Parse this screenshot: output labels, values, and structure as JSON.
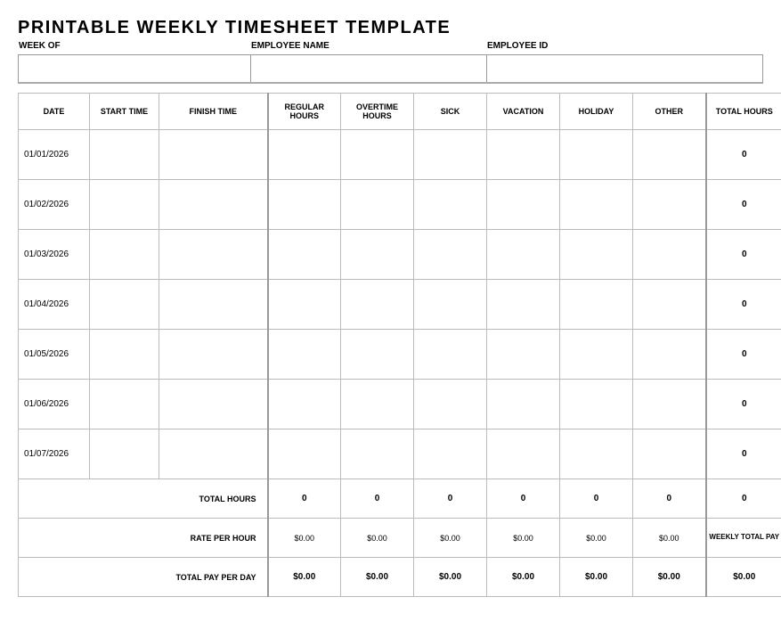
{
  "title": "PRINTABLE WEEKLY TIMESHEET TEMPLATE",
  "header": {
    "weekOfLabel": "WEEK OF",
    "weekOf": "",
    "employeeNameLabel": "EMPLOYEE NAME",
    "employeeName": "",
    "employeeIdLabel": "EMPLOYEE ID",
    "employeeId": ""
  },
  "columns": {
    "date": "DATE",
    "startTime": "START TIME",
    "finishTime": "FINISH TIME",
    "regular": "REGULAR HOURS",
    "overtime": "OVERTIME HOURS",
    "sick": "SICK",
    "vacation": "VACATION",
    "holiday": "HOLIDAY",
    "other": "OTHER",
    "total": "TOTAL HOURS"
  },
  "rows": [
    {
      "date": "01/01/2026",
      "start": "",
      "finish": "",
      "reg": "",
      "ot": "",
      "sick": "",
      "vac": "",
      "hol": "",
      "other": "",
      "total": "0"
    },
    {
      "date": "01/02/2026",
      "start": "",
      "finish": "",
      "reg": "",
      "ot": "",
      "sick": "",
      "vac": "",
      "hol": "",
      "other": "",
      "total": "0"
    },
    {
      "date": "01/03/2026",
      "start": "",
      "finish": "",
      "reg": "",
      "ot": "",
      "sick": "",
      "vac": "",
      "hol": "",
      "other": "",
      "total": "0"
    },
    {
      "date": "01/04/2026",
      "start": "",
      "finish": "",
      "reg": "",
      "ot": "",
      "sick": "",
      "vac": "",
      "hol": "",
      "other": "",
      "total": "0"
    },
    {
      "date": "01/05/2026",
      "start": "",
      "finish": "",
      "reg": "",
      "ot": "",
      "sick": "",
      "vac": "",
      "hol": "",
      "other": "",
      "total": "0"
    },
    {
      "date": "01/06/2026",
      "start": "",
      "finish": "",
      "reg": "",
      "ot": "",
      "sick": "",
      "vac": "",
      "hol": "",
      "other": "",
      "total": "0"
    },
    {
      "date": "01/07/2026",
      "start": "",
      "finish": "",
      "reg": "",
      "ot": "",
      "sick": "",
      "vac": "",
      "hol": "",
      "other": "",
      "total": "0"
    }
  ],
  "footer": {
    "totalHoursLabel": "TOTAL HOURS",
    "totals": {
      "reg": "0",
      "ot": "0",
      "sick": "0",
      "vac": "0",
      "hol": "0",
      "other": "0",
      "grand": "0"
    },
    "rateLabel": "RATE PER HOUR",
    "rates": {
      "reg": "$0.00",
      "ot": "$0.00",
      "sick": "$0.00",
      "vac": "$0.00",
      "hol": "$0.00",
      "other": "$0.00"
    },
    "weeklyTotalPayLabel": "WEEKLY TOTAL PAY",
    "totalPayLabel": "TOTAL PAY PER DAY",
    "pay": {
      "reg": "$0.00",
      "ot": "$0.00",
      "sick": "$0.00",
      "vac": "$0.00",
      "hol": "$0.00",
      "other": "$0.00",
      "weekly": "$0.00"
    }
  }
}
